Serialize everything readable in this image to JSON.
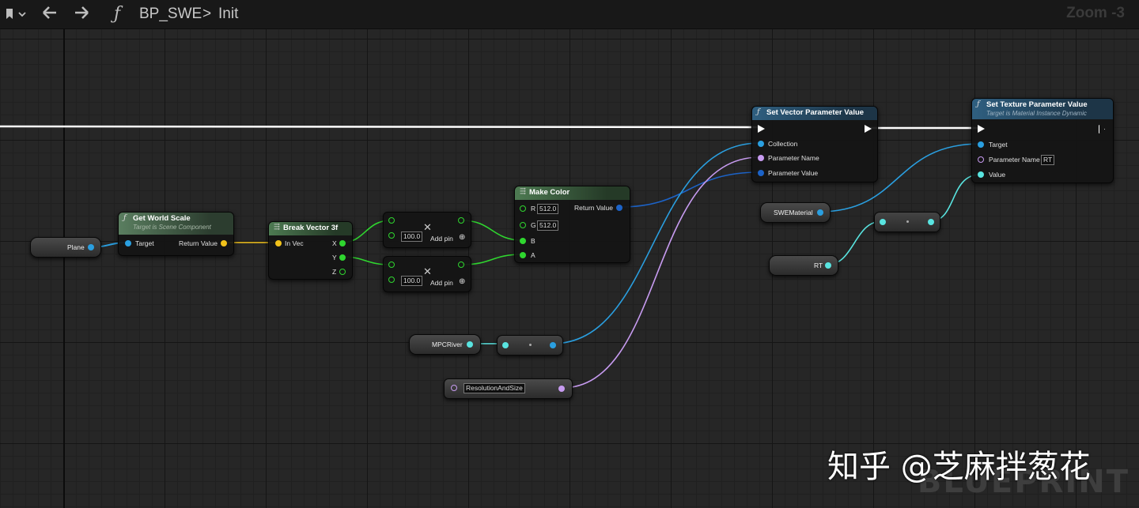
{
  "topbar": {
    "bookmark_icon": "bookmark-icon",
    "func_symbol": "ƒ",
    "blueprint": "BP_SWE",
    "separator": ">",
    "function": "Init",
    "zoom": "Zoom -3"
  },
  "nodes": {
    "get_world_scale": {
      "title": "Get World Scale",
      "subtitle": "Target is Scene Component",
      "target": "Target",
      "return": "Return Value"
    },
    "break_vector": {
      "title": "Break Vector 3f",
      "in_vec": "In Vec",
      "x": "X",
      "y": "Y",
      "z": "Z"
    },
    "multiply_1": {
      "value": "100.0",
      "add_pin": "Add pin"
    },
    "multiply_2": {
      "value": "100.0",
      "add_pin": "Add pin"
    },
    "make_color": {
      "title": "Make Color",
      "r": "R",
      "r_val": "512.0",
      "g": "G",
      "g_val": "512.0",
      "b": "B",
      "a": "A",
      "return": "Return Value"
    },
    "set_vector": {
      "title": "Set Vector Parameter Value",
      "collection": "Collection",
      "param_name": "Parameter Name",
      "param_value": "Parameter Value"
    },
    "set_texture": {
      "title": "Set Texture Parameter Value",
      "subtitle": "Target is Material Instance Dynamic",
      "target": "Target",
      "param_name": "Parameter Name",
      "param_name_val": "RT",
      "value": "Value"
    }
  },
  "variables": {
    "plane": "Plane",
    "mpc_river": "MPCRiver",
    "resolution": "ResolutionAndSize",
    "swe_material": "SWEMaterial",
    "rt": "RT"
  },
  "watermark": "BLUEPRINT",
  "overlay_text": "知乎 @芝麻拌葱花",
  "colors": {
    "object_pin": "#2a9fe0",
    "float_pin": "#2fd62f",
    "vector_pin": "#f2c21a",
    "name_pin": "#c79bf0",
    "texture_pin": "#59e4e0",
    "exec_wire": "#ffffff"
  }
}
